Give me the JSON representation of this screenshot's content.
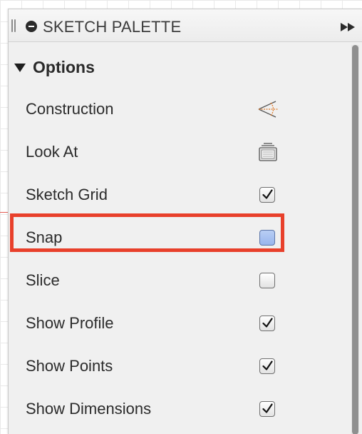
{
  "palette": {
    "title": "SKETCH PALETTE",
    "section": {
      "title": "Options"
    },
    "rows": [
      {
        "label": "Construction",
        "control": "construction-icon"
      },
      {
        "label": "Look At",
        "control": "look-at-icon"
      },
      {
        "label": "Sketch Grid",
        "control": "checkbox",
        "checked": true
      },
      {
        "label": "Snap",
        "control": "checkbox",
        "checked": false,
        "highlighted": true
      },
      {
        "label": "Slice",
        "control": "checkbox",
        "checked": false
      },
      {
        "label": "Show Profile",
        "control": "checkbox",
        "checked": true
      },
      {
        "label": "Show Points",
        "control": "checkbox",
        "checked": true
      },
      {
        "label": "Show Dimensions",
        "control": "checkbox",
        "checked": true
      }
    ]
  },
  "colors": {
    "highlight": "#e8402b",
    "snap_checkbox": "#a8c2f1",
    "panel_background": "#f0f0f0",
    "construction_icon": "#e07b2a"
  }
}
